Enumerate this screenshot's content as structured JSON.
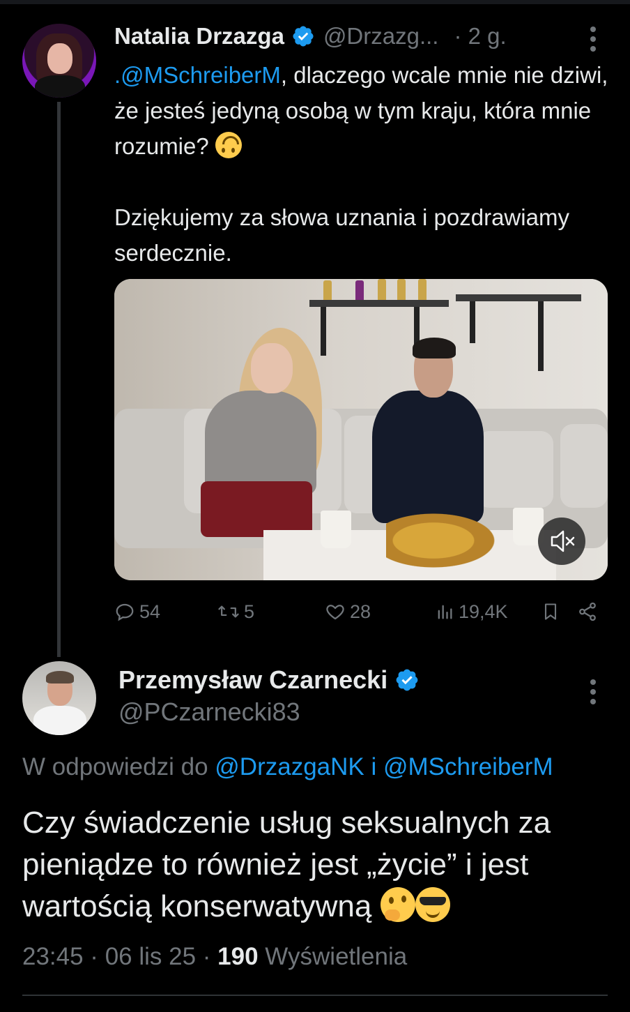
{
  "colors": {
    "background": "#000000",
    "text": "#e7e9ea",
    "muted": "#71767b",
    "accent": "#1d9bf0"
  },
  "tweet1": {
    "author_name": "Natalia Drzazga",
    "handle": "@Drzazg...",
    "time": "· 2 g.",
    "verified_icon": "verified-badge-icon",
    "text_mention": ".@MSchreiberM",
    "text_line1_rest": ", dlaczego wcale mnie nie dziwi, że jesteś jedyną osobą w tym kraju, która mnie rozumie?",
    "text_emoji": "upside-down-face-emoji",
    "text_para2": "Dziękujemy za słowa uznania i pozdrawiamy serdecznie.",
    "media": {
      "type": "video",
      "muted": true,
      "mute_icon": "speaker-muted-icon"
    },
    "actions": {
      "replies": "54",
      "retweets": "5",
      "likes": "28",
      "views": "19,4K"
    }
  },
  "tweet2": {
    "author_name": "Przemysław Czarnecki",
    "handle": "@PCzarnecki83",
    "verified_icon": "verified-badge-icon",
    "reply_prefix": "W odpowiedzi do ",
    "reply_mention1": "@DrzazgaNK",
    "reply_conj": " i ",
    "reply_mention2": "@MSchreiberM",
    "text": "Czy świadczenie usług seksualnych za pieniądze to również jest „życie” i jest wartością konserwatywną",
    "text_emojis": [
      "thinking-face-emoji",
      "smiling-face-with-sunglasses-emoji"
    ],
    "timestamp": "23:45 · 06 lis 25 · ",
    "views_count": "190",
    "views_label": " Wyświetlenia"
  }
}
